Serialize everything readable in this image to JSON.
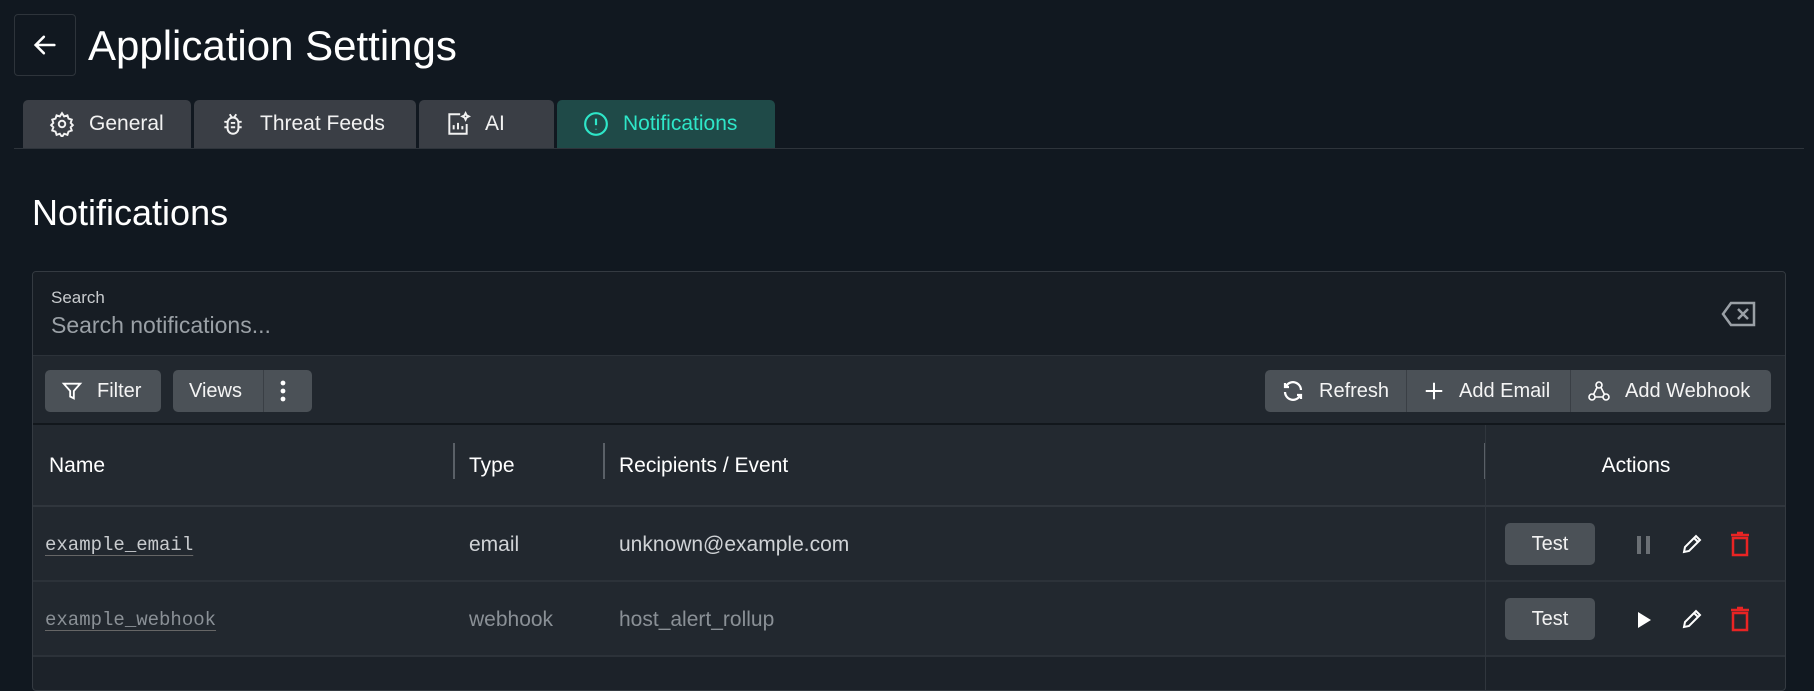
{
  "header": {
    "title": "Application Settings"
  },
  "tabs": [
    {
      "label": "General",
      "icon": "gear-icon"
    },
    {
      "label": "Threat Feeds",
      "icon": "bug-icon"
    },
    {
      "label": "AI",
      "icon": "ai-chart-icon"
    },
    {
      "label": "Notifications",
      "icon": "alert-circle-icon",
      "active": true
    }
  ],
  "section_title": "Notifications",
  "search": {
    "label": "Search",
    "placeholder": "Search notifications...",
    "value": ""
  },
  "toolbar": {
    "filter": "Filter",
    "views": "Views",
    "refresh": "Refresh",
    "add_email": "Add Email",
    "add_webhook": "Add Webhook"
  },
  "table": {
    "columns": [
      "Name",
      "Type",
      "Recipients / Event",
      "Actions"
    ],
    "rows": [
      {
        "name": "example_email",
        "type": "email",
        "target": "unknown@example.com",
        "test": "Test",
        "state": "active"
      },
      {
        "name": "example_webhook",
        "type": "webhook",
        "target": "host_alert_rollup",
        "test": "Test",
        "state": "paused"
      }
    ]
  },
  "colors": {
    "accent": "#2ee6c8",
    "danger": "#e82424",
    "bg": "#111820"
  }
}
